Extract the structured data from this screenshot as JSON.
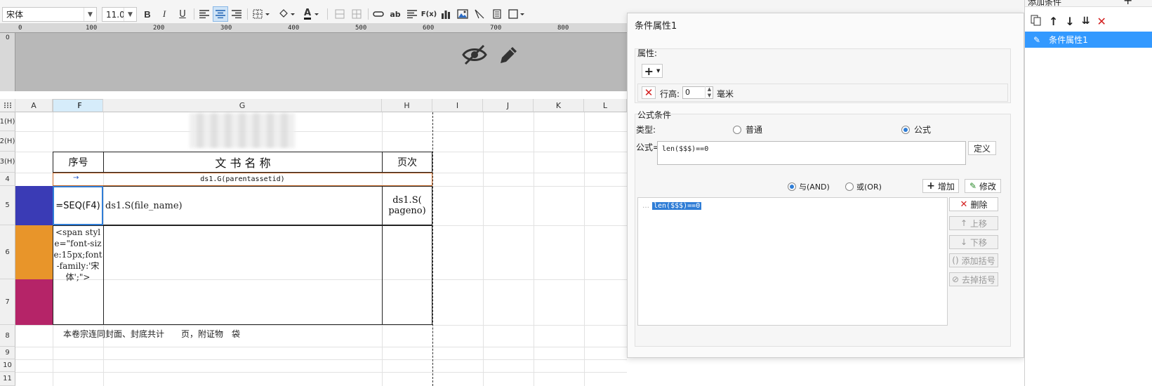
{
  "toolbar": {
    "font_name": "宋体",
    "font_size": "11.0",
    "bold": "B",
    "italic": "I",
    "underline": "U",
    "text_color_glyph": "A",
    "ab_label": "ab",
    "fx_label": "F(x)"
  },
  "ruler": {
    "ticks": [
      "0",
      "100",
      "200",
      "300",
      "400",
      "500",
      "600",
      "700",
      "800"
    ],
    "vertical_tick": "0"
  },
  "grid": {
    "columns": [
      "A",
      "F",
      "G",
      "H",
      "I",
      "J",
      "K",
      "L"
    ],
    "rows": [
      "1(H)",
      "2(H)",
      "3(H)",
      "4",
      "5",
      "6",
      "7",
      "8",
      "9",
      "10",
      "11"
    ],
    "header_seq": "序号",
    "header_title": "文 书 名 称",
    "header_page": "页次",
    "parent_formula": "ds1.G(parentassetid)",
    "seq_formula": "=SEQ(F4)",
    "file_name_formula": "ds1.S(file_name)",
    "pageno_formula": "ds1.S(\npageno)",
    "span_text": "<span style=\"font-size:15px;font-family:'宋体';\">",
    "footer_text": "本卷宗连同封面、封底共计　　页，附证物　袋",
    "row_colors": {
      "row5": "#3a3bb5",
      "row6": "#e8952a",
      "row7": "#b52468"
    }
  },
  "dialog": {
    "title": "条件属性1",
    "properties": {
      "label": "属性:",
      "add_symbol": "+",
      "row_height_label": "行高:",
      "row_height_value": "0",
      "unit": "毫米"
    },
    "formula_condition": {
      "label": "公式条件",
      "type_label": "类型:",
      "type_options": [
        {
          "label": "普通",
          "selected": false
        },
        {
          "label": "公式",
          "selected": true
        }
      ],
      "formula_label": "公式=",
      "formula_value": "len($$$)==0",
      "define_button": "定义",
      "and_label": "与(AND)",
      "or_label": "或(OR)",
      "add_button": "增加",
      "modify_button": "修改",
      "list_items": [
        "len($$$)==0"
      ],
      "side_buttons": [
        {
          "label": "删除",
          "enabled": true
        },
        {
          "label": "上移",
          "enabled": false
        },
        {
          "label": "下移",
          "enabled": false
        },
        {
          "label": "添加括号",
          "enabled": false
        },
        {
          "label": "去掉括号",
          "enabled": false
        }
      ]
    }
  },
  "right_panel": {
    "title": "添加条件",
    "add_symbol": "+",
    "items": [
      {
        "label": "条件属性1",
        "selected": true
      }
    ]
  },
  "colors": {
    "accent": "#2f7dd6",
    "selection_bg": "#3399ff",
    "delete_red": "#d32020"
  }
}
